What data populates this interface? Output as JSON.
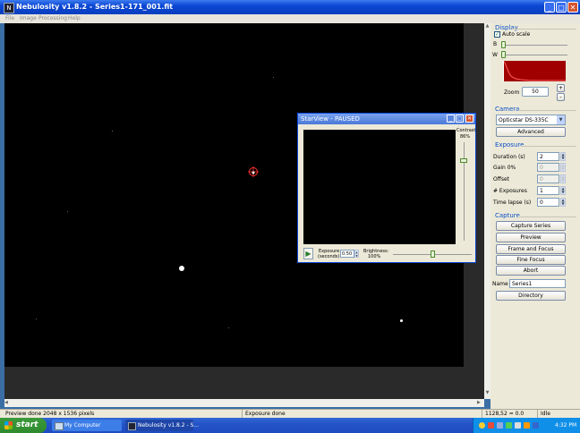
{
  "window": {
    "title": "Nebulosity v1.8.2 - Series1-171_001.fit",
    "min": "_",
    "max": "□",
    "close": "✕"
  },
  "menu": [
    "File",
    "Image",
    "Processing",
    "Help"
  ],
  "status": {
    "left": "Preview done 2048 x 1536 pixels",
    "center": "Exposure done",
    "coords": "1128,52 = 0.0",
    "state": "Idle"
  },
  "display": {
    "title": "Display",
    "autoscale_label": "Auto scale",
    "autoscale_checked": true,
    "b_label": "B",
    "w_label": "W",
    "zoom_label": "Zoom",
    "zoom_value": "50",
    "zoom_plus": "+",
    "zoom_minus": "-"
  },
  "camera": {
    "title": "Camera",
    "selected": "Opticstar DS-335C",
    "advanced": "Advanced"
  },
  "exposure": {
    "title": "Exposure",
    "rows": [
      {
        "label": "Duration (s)",
        "value": "2",
        "enabled": true
      },
      {
        "label": "Gain 0%",
        "value": "0",
        "enabled": false
      },
      {
        "label": "Offset",
        "value": "0",
        "enabled": false
      },
      {
        "label": "# Exposures",
        "value": "1",
        "enabled": true
      },
      {
        "label": "Time lapse (s)",
        "value": "0",
        "enabled": true
      }
    ]
  },
  "capture": {
    "title": "Capture",
    "buttons": [
      "Capture Series",
      "Preview",
      "Frame and Focus",
      "Fine Focus",
      "Abort",
      "Directory"
    ],
    "name_label": "Name",
    "name_value": "Series1"
  },
  "starview": {
    "title": "StarView - PAUSED",
    "contrast_label": "Contrast",
    "contrast_value": "86%",
    "play": "▶",
    "exposure_label": "Exposure",
    "exposure_sub": "(seconds)",
    "exposure_value": "0.50",
    "brightness_label": "Brightness:",
    "brightness_value": "100%",
    "contrast_level": 0.25,
    "brightness_level": 0.5
  },
  "taskbar": {
    "start": "start",
    "tasks": [
      "My Computer",
      "Nebulosity v1.8.2 - S..."
    ],
    "clock": "4:32 PM"
  },
  "colors": {
    "title_blue": "#0a46d3",
    "section_blue": "#0a50c8",
    "start_green": "#2d8a2d",
    "reticle_red": "#ff3030"
  }
}
